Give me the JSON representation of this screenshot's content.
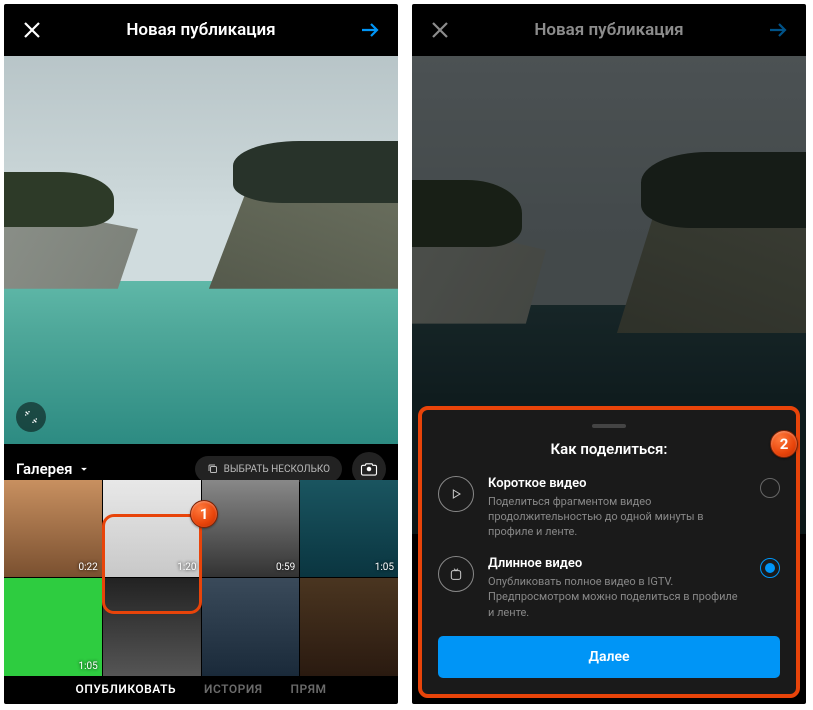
{
  "left": {
    "title": "Новая публикация",
    "gallery_label": "Галерея",
    "select_multiple": "ВЫБРАТЬ НЕСКОЛЬКО",
    "thumbs": [
      {
        "dur": "0:22",
        "bg": "linear-gradient(#c89060,#7a5030)"
      },
      {
        "dur": "1:20",
        "bg": "linear-gradient(#e8e8e8,#c8c8c8)"
      },
      {
        "dur": "0:59",
        "bg": "linear-gradient(#888,#333)"
      },
      {
        "dur": "1:05",
        "bg": "linear-gradient(#1a5560,#0a3540)"
      },
      {
        "dur": "1:05",
        "bg": "#2ecc40"
      },
      {
        "dur": "",
        "bg": "linear-gradient(#222,#555)"
      },
      {
        "dur": "",
        "bg": "linear-gradient(#3a4a5a,#1a2a3a)"
      },
      {
        "dur": "",
        "bg": "linear-gradient(#4a3520,#2a1a10)"
      }
    ],
    "tabs": {
      "publish": "ОПУБЛИКОВАТЬ",
      "story": "ИСТОРИЯ",
      "live": "ПРЯМ"
    },
    "marker": "1"
  },
  "right": {
    "title": "Новая публикация",
    "sheet_title": "Как поделиться:",
    "opt_short": {
      "title": "Короткое видео",
      "desc": "Поделиться фрагментом видео продолжительностью до одной минуты в профиле и ленте."
    },
    "opt_long": {
      "title": "Длинное видео",
      "desc": "Опубликовать полное видео в IGTV. Предпросмотром можно поделиться в профиле и ленте."
    },
    "next": "Далее",
    "marker": "2"
  }
}
